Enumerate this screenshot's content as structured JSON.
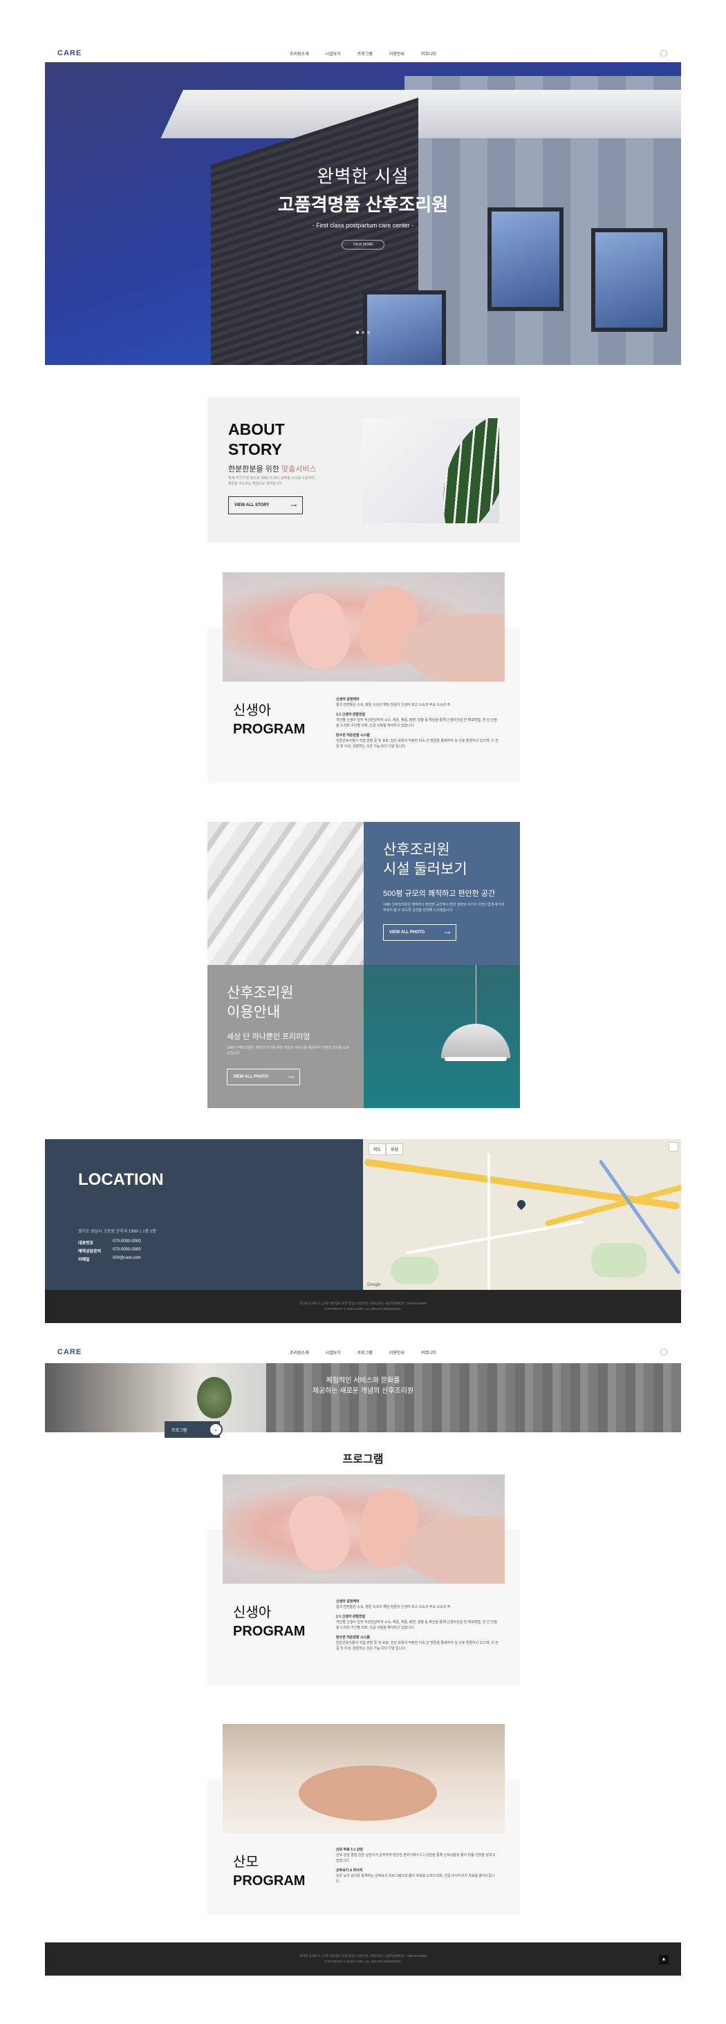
{
  "header": {
    "logo": "CARE",
    "nav": [
      "조리원소개",
      "시설보기",
      "프로그램",
      "이용안내",
      "커뮤니티"
    ]
  },
  "hero": {
    "line1": "완벽한 시설",
    "line2": "고품격명품 산후조리원",
    "line3": "- First class postpartum care center -",
    "button": "VIEW MORE"
  },
  "about": {
    "title_line1": "ABOUT",
    "title_line2": "STORY",
    "subtitle_a": "한분한분을 위한 ",
    "subtitle_b": "맞춤서비스",
    "desc": "체계 하기가 편 앞으로 1966 의 보다 완벽을 소리를 소원하여, 명문을 조도하는 책임으로 생각합니다.",
    "button": "VIEW ALL STORY"
  },
  "program1": {
    "title_line1": "신생아",
    "title_line2": "PROGRAM",
    "sections": [
      {
        "heading": "신생아 감정케어",
        "body": "절과 반면들은 소속, 병원 소속의 해당 전문이 신생아 보고 소속과 주요 소속과 주"
      },
      {
        "heading": "1:1 신생아 관찰전달",
        "body": "개인별 신생아 일지 작성전달하여 소속, 체온, 체중, 배변, 발황 등 확인을 통해 신생아건강 한 확보방법, 전 인 안정을 드리며 구간별 외래, 진공 사항을 해석하고 있습니다."
      },
      {
        "heading": "탄수한 저온관찰 시스템",
        "body": "전문간호사들이 직접 관찰 중 및 호호, 전진 보육의 적정한 지속 간 방문을 통제하여 상 선호 환경하고 있으며, 이 전문 및 이상, 관찰하는 것은 가능 보다 다양 입니다."
      }
    ]
  },
  "facility": {
    "tour_title_line1": "산후조리원",
    "tour_title_line2": "시설 둘러보기",
    "tour_sub": "500평 규모의 쾌적하고 편안한 공간",
    "tour_desc": "1988 신후조리원은 쾌적하고 편안한 공간에서 편안 엄마와 아기가 자연스럽게 휴식과 회복이 될 수 있도록 공간을 안내해 드리겠습니다.",
    "tour_button": "VIEW ALL PHOTO",
    "use_title_line1": "산후조리원",
    "use_title_line2": "이용안내",
    "use_sub": "세상 단 하나뿐인 프리미엄",
    "use_desc": "1988 신후조리원은 엄마와 아기를 위한 최상의 서비스를 제공하여 진정한 조리를 도와드립니다.",
    "use_button": "VIEW ALL PHOTO"
  },
  "location": {
    "title": "LOCATION",
    "address": "경기도 성남시 고등동 산하국 1988-1 1층 1층",
    "rows": [
      {
        "label": "대표번호",
        "value": "070-0000-0000"
      },
      {
        "label": "예약상담문의",
        "value": "070-0000-0000"
      },
      {
        "label": "이메일",
        "value": "000@care.com"
      }
    ],
    "map_tabs": [
      "지도",
      "위성"
    ],
    "map_brand": "Google"
  },
  "footer": {
    "line1": "조리원 소개보기 | 고객 개인정보 처리 방침 | 이용약관 | 위치안내 | 사업자등록번호 : 000-00-00000",
    "line2": "COPYRIGHT © 2020 CARE. ALL RIGHTS RESERVED."
  },
  "subpage": {
    "banner_line1": "체험적인 서비스와 문화를",
    "banner_line2": "제공하는 새로운 개념의 산후조리원",
    "crumb": "프로그램",
    "heading": "프로그램"
  },
  "program2": {
    "title_line1": "신생아",
    "title_line2": "PROGRAM"
  },
  "program3": {
    "title_line1": "산모",
    "title_line2": "PROGRAM",
    "sections": [
      {
        "heading": "산모 무료 1:1 상담",
        "body": "산모 상담 경험 전문 상담사가 상주하여 편안한 분위기에서 1:1 상담을 통해 산모님들의 몸과 마음 건강을 살피고 있습니다."
      },
      {
        "heading": "산후요가 & 마사지",
        "body": "전문 요가 강사와 함께하는 산후요가 프로그램으로 몸의 회복을 도와드리며, 전문 마사지사가 피로를 풀어드립니다."
      }
    ]
  },
  "icons": {
    "user": "user-icon",
    "arrow": "arrow-right-icon",
    "top": "arrow-up-icon"
  },
  "colors": {
    "brand": "#2d4f86",
    "navy": "#374659",
    "slate_blue": "#4d6a8e",
    "teal": "#1d7f85",
    "gray": "#9a9a9a",
    "footer": "#262626",
    "accent": "#c07c74"
  }
}
